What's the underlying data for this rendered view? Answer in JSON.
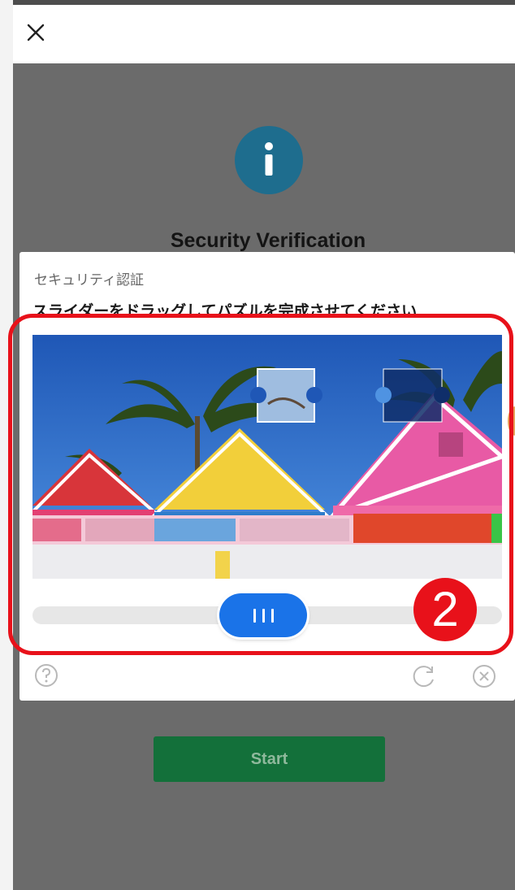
{
  "window": {
    "close_icon": "close-icon"
  },
  "background": {
    "info_icon": "info-icon",
    "title": "Security Verification",
    "start_label": "Start"
  },
  "captcha": {
    "title": "セキュリティ認証",
    "instruction": "スライダーをドラッグしてパズルを完成させてください",
    "slider_position": 0.49,
    "icons": {
      "help": "help-icon",
      "refresh": "refresh-icon",
      "close": "close-circle-icon"
    }
  },
  "annotation": {
    "step_number": "2",
    "highlight_color": "#e8111a"
  },
  "colors": {
    "slider_handle": "#1a73e8",
    "start_button": "#13703a",
    "info_circle": "#1e6d8e"
  }
}
